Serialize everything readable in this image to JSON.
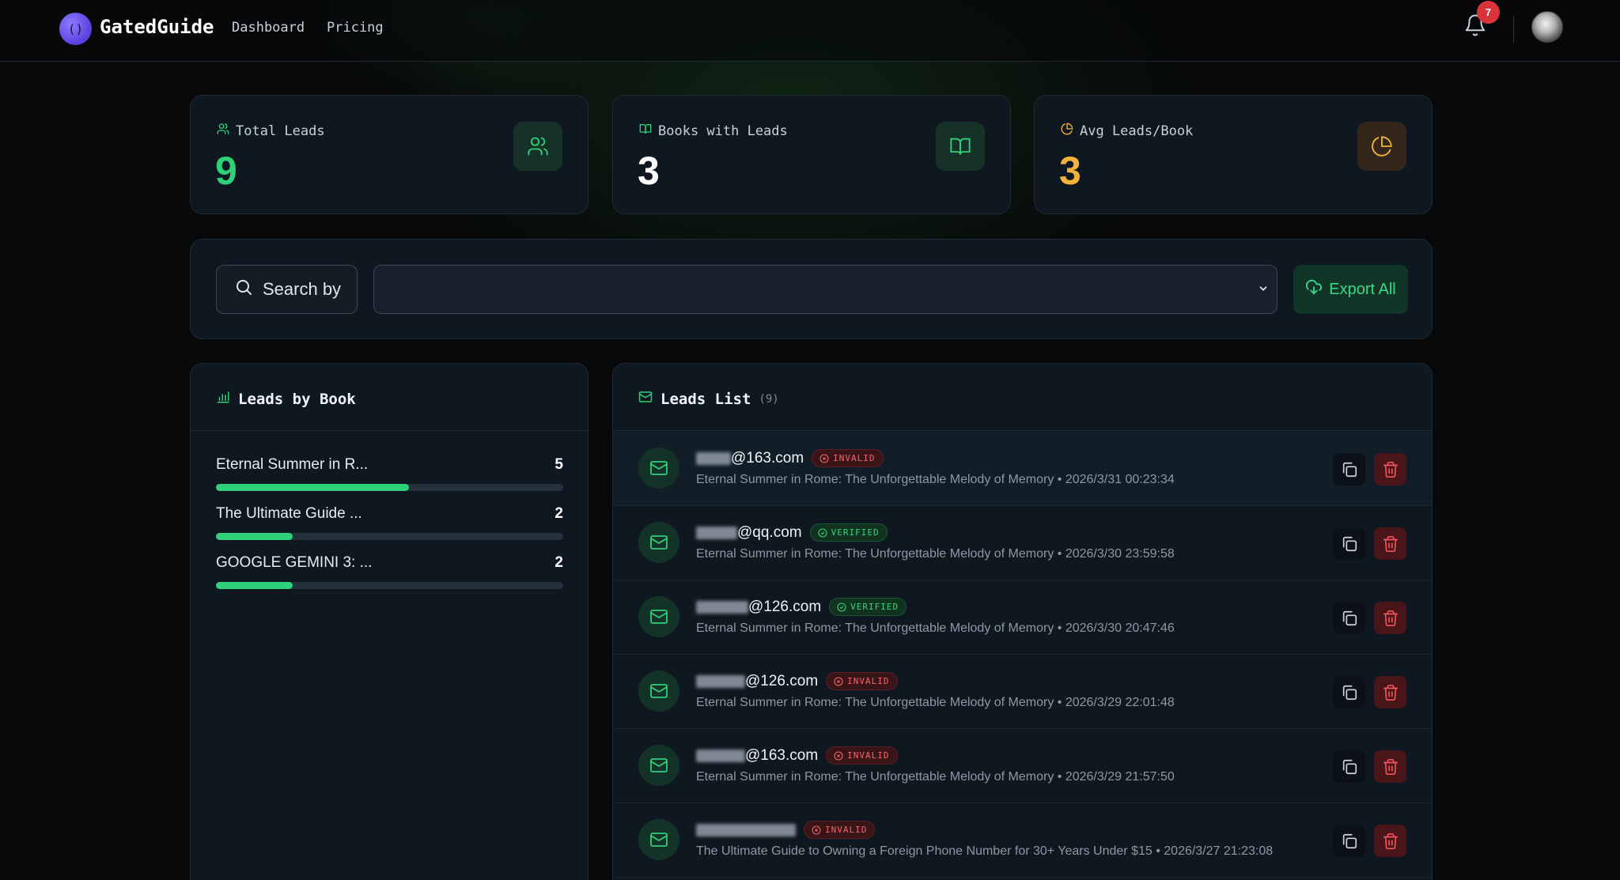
{
  "header": {
    "logo_glyph": "()",
    "brand": "GatedGuide",
    "nav": [
      "Dashboard",
      "Pricing"
    ],
    "notification_count": "7"
  },
  "stats": [
    {
      "label": "Total Leads",
      "value": "9",
      "icon": "users-icon",
      "color": "#2fd07a"
    },
    {
      "label": "Books with Leads",
      "value": "3",
      "icon": "book-icon",
      "color": "#ffffff"
    },
    {
      "label": "Avg Leads/Book",
      "value": "3",
      "icon": "pie-chart-icon",
      "color": "#f5b23a"
    }
  ],
  "search": {
    "button_label": "Search by",
    "select_value": "",
    "export_label": "Export All"
  },
  "books_panel": {
    "title": "Leads by Book",
    "items": [
      {
        "name": "Eternal Summer in R...",
        "count": "5",
        "fraction": 0.556
      },
      {
        "name": "The Ultimate Guide ...",
        "count": "2",
        "fraction": 0.222
      },
      {
        "name": "GOOGLE GEMINI 3: ...",
        "count": "2",
        "fraction": 0.222
      }
    ]
  },
  "leads_panel": {
    "title": "Leads List",
    "count": "(9)",
    "items": [
      {
        "email_suffix": "@163.com",
        "status": "INVALID",
        "meta": "Eternal Summer in Rome: The Unforgettable Melody of Memory • 2026/3/31 00:23:34"
      },
      {
        "email_suffix": "@qq.com",
        "status": "VERIFIED",
        "meta": "Eternal Summer in Rome: The Unforgettable Melody of Memory • 2026/3/30 23:59:58"
      },
      {
        "email_suffix": "@126.com",
        "status": "VERIFIED",
        "meta": "Eternal Summer in Rome: The Unforgettable Melody of Memory • 2026/3/30 20:47:46"
      },
      {
        "email_suffix": "@126.com",
        "status": "INVALID",
        "meta": "Eternal Summer in Rome: The Unforgettable Melody of Memory • 2026/3/29 22:01:48"
      },
      {
        "email_suffix": "@163.com",
        "status": "INVALID",
        "meta": "Eternal Summer in Rome: The Unforgettable Melody of Memory • 2026/3/29 21:57:50"
      },
      {
        "email_suffix": "",
        "status": "INVALID",
        "meta": "The Ultimate Guide to Owning a Foreign Phone Number for 30+ Years Under $15 • 2026/3/27 21:23:08"
      }
    ]
  }
}
